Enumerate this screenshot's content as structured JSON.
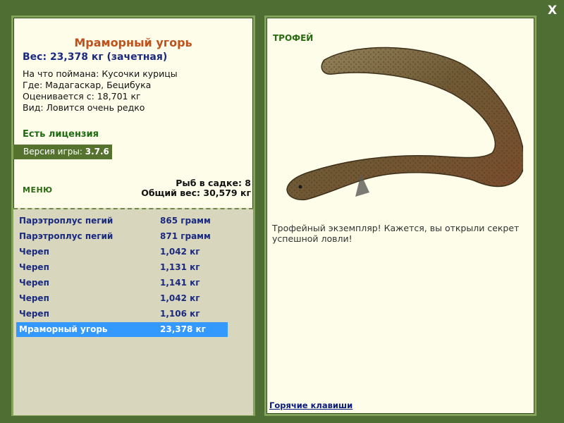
{
  "close_label": "X",
  "fish": {
    "name": "Мраморный угорь",
    "weight_line": "Вес: 23,378 кг (зачетная)",
    "info": [
      "На что поймана: Кусочки курицы",
      "Где: Мадагаскар, Бецибука",
      "Оценивается с: 18,701 кг",
      "Вид: Ловится очень редко"
    ]
  },
  "license_text": "Есть лицензия",
  "version": {
    "label": "Версия игры: ",
    "value": "3.7.6"
  },
  "menu_label": "МЕНЮ",
  "keepnet": {
    "count_line": "Рыб в садке: 8",
    "total_line": "Общий вес: 30,579 кг"
  },
  "catches": [
    {
      "name": "Парэтроплус пегий",
      "weight": "865 грамм"
    },
    {
      "name": "Парэтроплус пегий",
      "weight": "871 грамм"
    },
    {
      "name": "Череп",
      "weight": "1,042 кг"
    },
    {
      "name": "Череп",
      "weight": "1,131 кг"
    },
    {
      "name": "Череп",
      "weight": "1,141 кг"
    },
    {
      "name": "Череп",
      "weight": "1,042 кг"
    },
    {
      "name": "Череп",
      "weight": "1,106 кг"
    },
    {
      "name": "Мраморный угорь",
      "weight": "23,378 кг"
    }
  ],
  "selected_index": 7,
  "trophy_label": "ТРОФЕЙ",
  "trophy_text": "Трофейный экземпляр! Кажется, вы открыли секрет успешной ловли!",
  "hotkeys_label": "Горячие клавиши",
  "colors": {
    "background": "#4f6e33",
    "panel": "#fdfde9",
    "selection": "#3399ff",
    "fish_name": "#c0511c"
  }
}
